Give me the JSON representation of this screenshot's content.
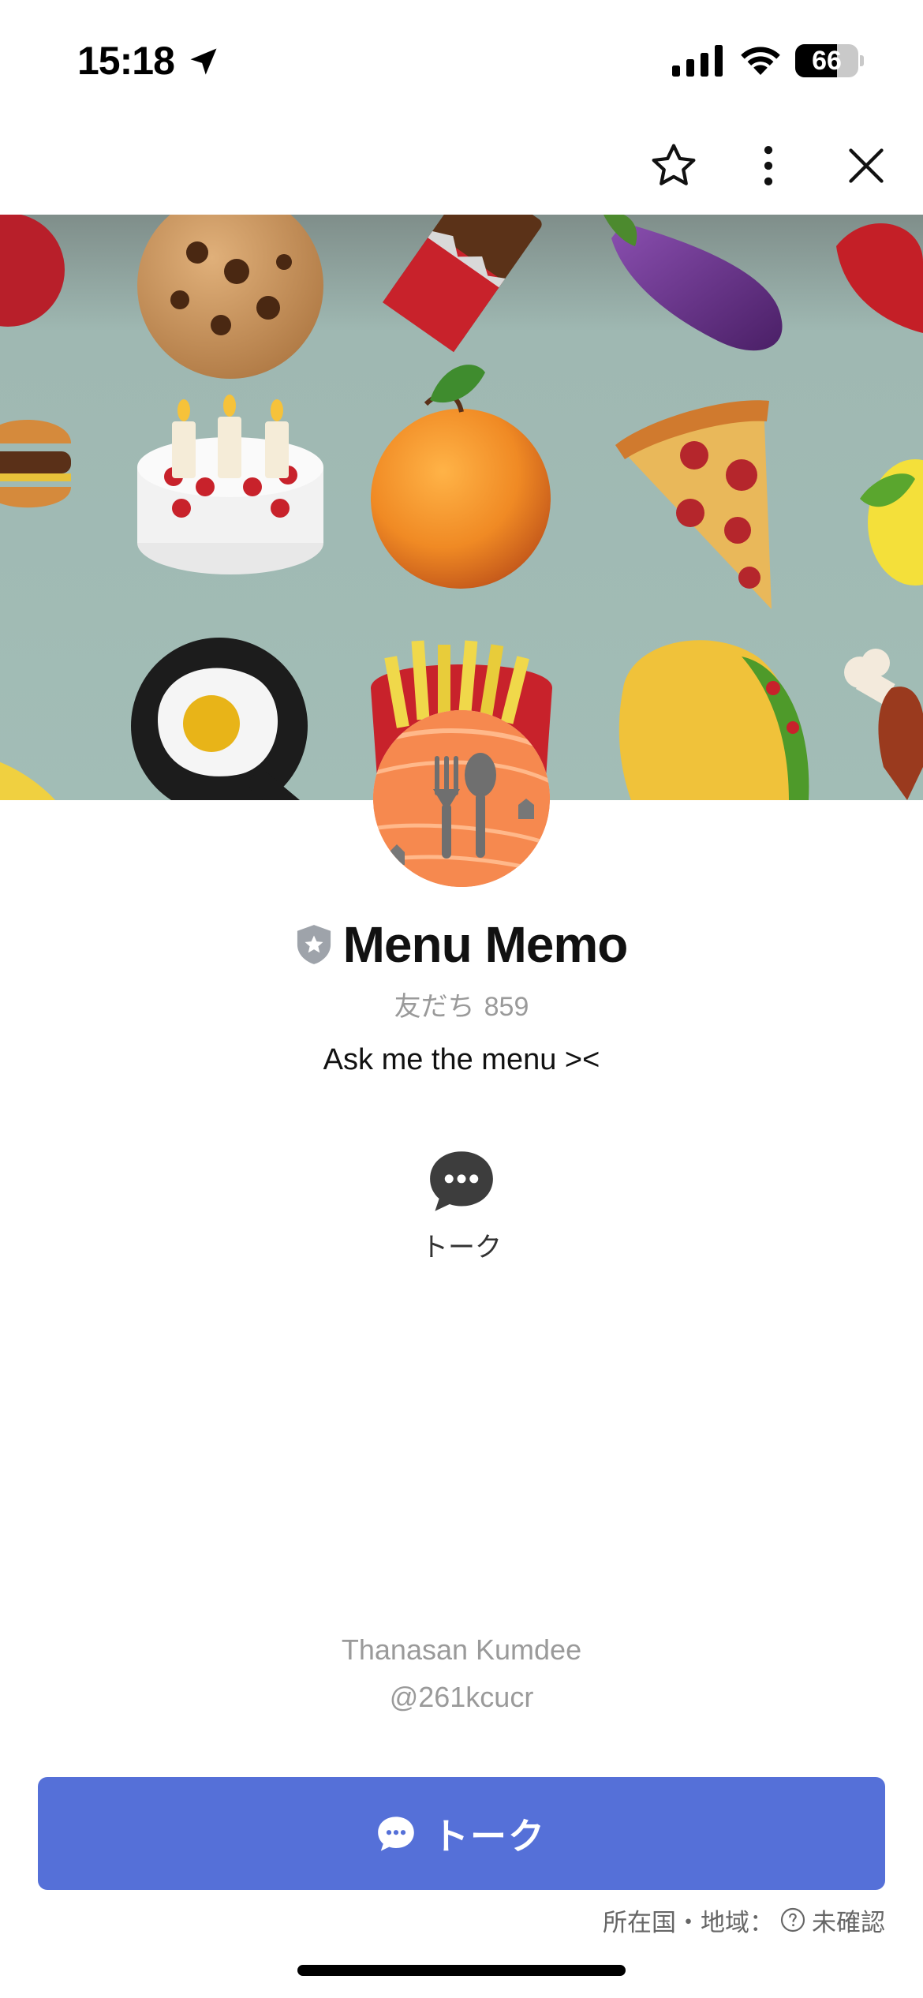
{
  "status_bar": {
    "time": "15:18",
    "battery_level": "66",
    "battery_fraction": 0.66
  },
  "top_actions": {
    "favorite_icon": "star-icon",
    "more_icon": "more-vertical-icon",
    "close_icon": "close-icon"
  },
  "profile": {
    "name": "Menu Memo",
    "badge_icon": "shield-star-icon",
    "friends_label": "友だち",
    "friends_count": "859",
    "status_message": "Ask me the menu ><"
  },
  "actions": {
    "talk_label": "トーク"
  },
  "owner": {
    "name": "Thanasan Kumdee",
    "id": "@261kcucr"
  },
  "primary_button": {
    "label": "トーク"
  },
  "region": {
    "label": "所在国・地域：",
    "value": "未確認"
  },
  "colors": {
    "accent": "#5570d8",
    "cover_bg": "#9fb8b2",
    "avatar_bg": "#f07a45"
  }
}
